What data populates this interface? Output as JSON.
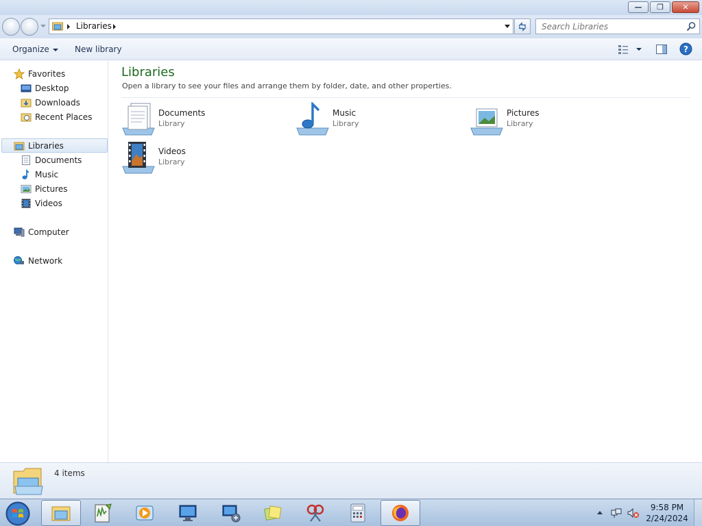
{
  "window": {
    "minimize_icon": "minimize-icon",
    "maximize_icon": "restore-icon",
    "close_icon": "close-icon"
  },
  "address": {
    "path": "Libraries",
    "search_placeholder": "Search Libraries"
  },
  "toolbar": {
    "organize_label": "Organize",
    "new_library_label": "New library"
  },
  "nav": {
    "favorites": {
      "label": "Favorites",
      "items": [
        {
          "label": "Desktop",
          "icon": "desktop-icon"
        },
        {
          "label": "Downloads",
          "icon": "downloads-folder-icon"
        },
        {
          "label": "Recent Places",
          "icon": "recent-places-icon"
        }
      ]
    },
    "libraries": {
      "label": "Libraries",
      "items": [
        {
          "label": "Documents",
          "icon": "documents-icon"
        },
        {
          "label": "Music",
          "icon": "music-icon"
        },
        {
          "label": "Pictures",
          "icon": "pictures-icon"
        },
        {
          "label": "Videos",
          "icon": "videos-icon"
        }
      ]
    },
    "computer": {
      "label": "Computer"
    },
    "network": {
      "label": "Network"
    }
  },
  "main": {
    "title": "Libraries",
    "description": "Open a library to see your files and arrange them by folder, date, and other properties.",
    "libraries": [
      {
        "name": "Documents",
        "type": "Library"
      },
      {
        "name": "Music",
        "type": "Library"
      },
      {
        "name": "Pictures",
        "type": "Library"
      },
      {
        "name": "Videos",
        "type": "Library"
      }
    ]
  },
  "status": {
    "item_count": "4 items"
  },
  "taskbar": {
    "clock_time": "9:58 PM",
    "clock_date": "2/24/2024",
    "apps": [
      "windows-explorer-icon",
      "notepad-plus-plus-icon",
      "media-player-icon",
      "remote-desktop-icon",
      "network-computer-icon",
      "sticky-notes-icon",
      "snipping-tool-icon",
      "calculator-icon",
      "firefox-icon"
    ]
  },
  "colors": {
    "title_green": "#1e6a1e",
    "accent_blue": "#c9d9ee"
  }
}
